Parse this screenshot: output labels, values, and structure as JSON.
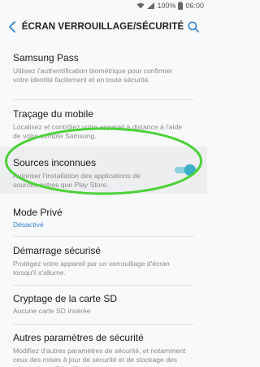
{
  "status_bar": {
    "battery": "100%",
    "time": "06:00",
    "icons": [
      "wifi-icon",
      "signal-icon",
      "battery-icon"
    ]
  },
  "header": {
    "title": "ÉCRAN VERROUILLAGE/SÉCURITÉ",
    "back_icon": "chevron-left-icon",
    "search_icon": "search-icon"
  },
  "items": [
    {
      "id": "samsung-pass",
      "title": "Samsung Pass",
      "desc": "Utilisez l'authentification biométrique pour confirmer votre identité facilement et en toute sécurité."
    },
    {
      "id": "tracage-mobile",
      "title": "Traçage du mobile",
      "desc": "Localisez et contrôlez votre appareil à distance à l'aide de votre compte Samsung."
    },
    {
      "id": "sources-inconnues",
      "title": "Sources inconnues",
      "desc": "Autoriser l'installation des applications de sources autres que Play Store.",
      "toggle": true
    },
    {
      "id": "mode-prive",
      "title": "Mode Privé",
      "status": "Désactivé"
    },
    {
      "id": "demarrage-securise",
      "title": "Démarrage sécurisé",
      "desc": "Protégez votre appareil par un verrouillage d'écran lorsqu'il s'allume."
    },
    {
      "id": "cryptage-sd",
      "title": "Cryptage de la carte SD",
      "value": "Aucune carte SD insérée"
    },
    {
      "id": "autres-parametres",
      "title": "Autres paramètres de sécurité",
      "desc": "Modifiez d'autres paramètres de sécurité, et notamment ceux des mises à jour de sécurité et de stockage des informations d'identification."
    }
  ],
  "colors": {
    "accent": "#3ab1c8",
    "link": "#2f7fd1",
    "highlight": "#4cd137"
  }
}
